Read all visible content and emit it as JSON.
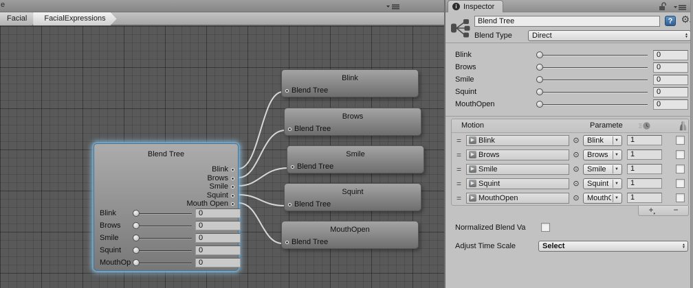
{
  "graph": {
    "tab_fragment": "e",
    "breadcrumbs": [
      "Facial",
      "FacialExpressions"
    ],
    "root_node": {
      "title": "Blend Tree",
      "output_pins": [
        "Blink",
        "Brows",
        "Smile",
        "Squint",
        "Mouth Open"
      ],
      "sliders": [
        {
          "label": "Blink",
          "value": "0"
        },
        {
          "label": "Brows",
          "value": "0"
        },
        {
          "label": "Smile",
          "value": "0"
        },
        {
          "label": "Squint",
          "value": "0"
        },
        {
          "label": "MouthOp",
          "value": "0"
        }
      ]
    },
    "child_nodes": [
      {
        "title": "Blink",
        "input_pin": "Blend Tree"
      },
      {
        "title": "Brows",
        "input_pin": "Blend Tree"
      },
      {
        "title": "Smile",
        "input_pin": "Blend Tree"
      },
      {
        "title": "Squint",
        "input_pin": "Blend Tree"
      },
      {
        "title": "MouthOpen",
        "input_pin": "Blend Tree"
      }
    ]
  },
  "inspector": {
    "tab": "Inspector",
    "info_glyph": "i",
    "name": "Blend Tree",
    "help_glyph": "?",
    "gear_glyph": "⚙",
    "blend_type": {
      "label": "Blend Type",
      "value": "Direct"
    },
    "parameters": [
      {
        "label": "Blink",
        "value": "0"
      },
      {
        "label": "Brows",
        "value": "0"
      },
      {
        "label": "Smile",
        "value": "0"
      },
      {
        "label": "Squint",
        "value": "0"
      },
      {
        "label": "MouthOpen",
        "value": "0"
      }
    ],
    "motion_list": {
      "motion_header": "Motion",
      "parameter_header": "Paramete",
      "rows": [
        {
          "motion": "Blink",
          "parameter": "Blink",
          "value": "1"
        },
        {
          "motion": "Brows",
          "parameter": "Brows",
          "value": "1"
        },
        {
          "motion": "Smile",
          "parameter": "Smile",
          "value": "1"
        },
        {
          "motion": "Squint",
          "parameter": "Squint",
          "value": "1"
        },
        {
          "motion": "MouthOpen",
          "parameter": "MouthOpen",
          "value": "1"
        }
      ],
      "play_glyph": "▶",
      "picker_glyph": "⊙",
      "add_label": "+",
      "remove_label": "−",
      "handle_glyph": "="
    },
    "normalized_blend": {
      "label": "Normalized Blend Va"
    },
    "adjust_time_scale": {
      "label": "Adjust Time Scale",
      "value": "Select"
    }
  },
  "colors": {
    "graph_background": "#595959",
    "panel_background": "#c2c2c2",
    "selection_glow": "#8cc4e6",
    "wire": "#e0e0e0",
    "help_icon_blue": "#2d5d92"
  }
}
